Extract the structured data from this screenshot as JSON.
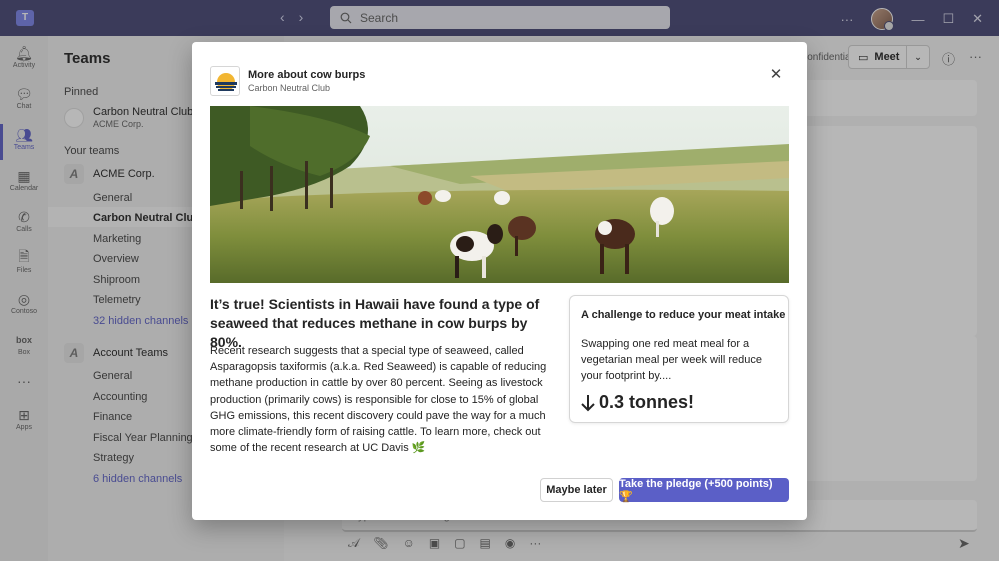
{
  "titlebar": {
    "search_placeholder": "Search",
    "nav_back": "‹",
    "nav_forward": "›",
    "more": "···"
  },
  "rail": {
    "items": [
      {
        "label": "Activity",
        "icon": "bell-icon"
      },
      {
        "label": "Chat",
        "icon": "chat-icon"
      },
      {
        "label": "Teams",
        "icon": "teams-icon"
      },
      {
        "label": "Calendar",
        "icon": "calendar-icon"
      },
      {
        "label": "Calls",
        "icon": "phone-icon"
      },
      {
        "label": "Files",
        "icon": "file-icon"
      },
      {
        "label": "Contoso",
        "icon": "contoso-icon"
      },
      {
        "label": "Box",
        "icon": "box-icon"
      },
      {
        "label": "",
        "icon": "more-icon"
      },
      {
        "label": "Apps",
        "icon": "apps-icon"
      }
    ]
  },
  "panel": {
    "title": "Teams",
    "pinned_label": "Pinned",
    "pinned_name": "Carbon Neutral Club",
    "pinned_org": "ACME Corp.",
    "your_teams_label": "Your teams",
    "team1": {
      "name": "ACME Corp.",
      "channels": [
        "General",
        "Carbon Neutral Club",
        "Marketing",
        "Overview",
        "Shiproom",
        "Telemetry"
      ],
      "hidden": "32 hidden channels"
    },
    "team2": {
      "name": "Account Teams",
      "channels": [
        "General",
        "Accounting",
        "Finance",
        "Fiscal Year Planning",
        "Strategy"
      ],
      "hidden": "6 hidden channels"
    }
  },
  "header": {
    "confidential": "Confidential",
    "meet_label": "Meet"
  },
  "compose": {
    "placeholder": "Type a new message"
  },
  "dialog": {
    "title": "More about cow burps",
    "subtitle": "Carbon Neutral Club",
    "headline": "It’s true! Scientists in Hawaii have found a type of seaweed that reduces methane in cow burps by 80%.",
    "body": "Recent research suggests that a special type of seaweed, called Asparagopsis taxiformis (a.k.a. Red Seaweed) is capable of reducing methane production in cattle by over 80 percent. Seeing as livestock production (primarily cows) is responsible for close to 15% of global GHG emissions, this recent discovery could pave the way for a much more climate-friendly form of raising cattle. To learn more, check out some of the recent research at UC Davis 🌿",
    "challenge": {
      "title": "A challenge to reduce your meat intake",
      "text": "Swapping one red meat meal for a vegetarian meal per week will reduce your footprint by....",
      "value": "0.3 tonnes!"
    },
    "buttons": {
      "later": "Maybe later",
      "pledge": "Take the pledge (+500 points) 🏆"
    }
  },
  "colors": {
    "titlebar": "#464775",
    "accent": "#5b5fc7"
  }
}
